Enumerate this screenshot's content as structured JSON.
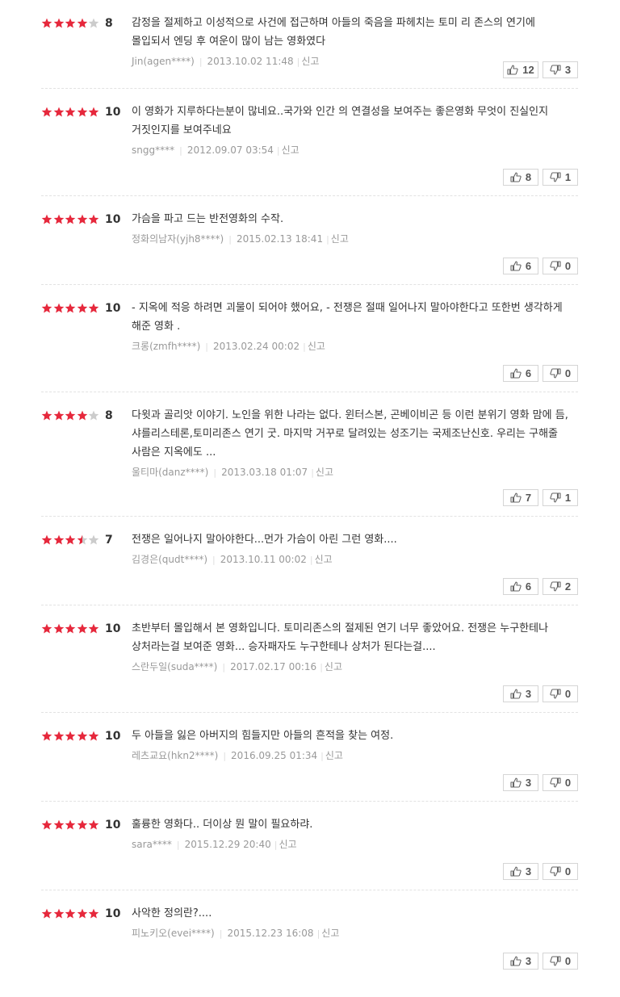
{
  "colors": {
    "star_on": "#e6283c",
    "star_off": "#cccccc"
  },
  "report_label": "신고",
  "reviews": [
    {
      "score": "8",
      "stars": [
        1,
        1,
        1,
        1,
        0
      ],
      "text": "감정을 절제하고 이성적으로 사건에 접근하며 아들의 죽음을 파헤치는 토미 리 존스의 연기에 몰입되서 엔딩 후 여운이 많이 남는 영화였다",
      "author": "Jin(agen****)",
      "date": "2013.10.02 11:48",
      "up": "12",
      "down": "3"
    },
    {
      "score": "10",
      "stars": [
        1,
        1,
        1,
        1,
        1
      ],
      "text": "이 영화가 지루하다는분이 많네요..국가와 인간 의 연결성을 보여주는 좋은영화 무엇이 진실인지 거짓인지를 보여주네요",
      "author": "sngg****",
      "date": "2012.09.07 03:54",
      "up": "8",
      "down": "1"
    },
    {
      "score": "10",
      "stars": [
        1,
        1,
        1,
        1,
        1
      ],
      "text": "가슴을 파고 드는 반전영화의 수작.",
      "author": "정화의남자(yjh8****)",
      "date": "2015.02.13 18:41",
      "up": "6",
      "down": "0"
    },
    {
      "score": "10",
      "stars": [
        1,
        1,
        1,
        1,
        1
      ],
      "text": "- 지옥에 적응 하려면 괴물이 되어야 했어요, - 전쟁은 절때 일어나지 말아야한다고 또한번 생각하게 해준 영화 .",
      "author": "크롱(zmfh****)",
      "date": "2013.02.24 00:02",
      "up": "6",
      "down": "0"
    },
    {
      "score": "8",
      "stars": [
        1,
        1,
        1,
        1,
        0
      ],
      "text": "다윗과 골리앗 이야기. 노인을 위한 나라는 없다. 윈터스본, 곤베이비곤 등 이런 분위기 영화 맘에 듬, 샤를리스테론,토미리존스 연기 굿. 마지막 거꾸로 달려있는 성조기는 국제조난신호. 우리는 구해줄 사람은 지옥에도 ...",
      "author": "울티마(danz****)",
      "date": "2013.03.18 01:07",
      "up": "7",
      "down": "1"
    },
    {
      "score": "7",
      "stars": [
        1,
        1,
        1,
        0.5,
        0
      ],
      "text": "전쟁은 일어나지 말아야한다...먼가 가슴이 아린 그런 영화....",
      "author": "김경은(qudt****)",
      "date": "2013.10.11 00:02",
      "up": "6",
      "down": "2"
    },
    {
      "score": "10",
      "stars": [
        1,
        1,
        1,
        1,
        1
      ],
      "text": "초반부터 몰입해서 본 영화입니다. 토미리존스의 절제된 연기 너무 좋았어요. 전쟁은 누구한테나 상처라는걸 보여준 영화... 승자패자도 누구한테나 상처가 된다는걸....",
      "author": "스란두일(suda****)",
      "date": "2017.02.17 00:16",
      "up": "3",
      "down": "0"
    },
    {
      "score": "10",
      "stars": [
        1,
        1,
        1,
        1,
        1
      ],
      "text": "두 아들을 잃은 아버지의 힘들지만 아들의 흔적을 찾는 여정.",
      "author": "레츠교요(hkn2****)",
      "date": "2016.09.25 01:34",
      "up": "3",
      "down": "0"
    },
    {
      "score": "10",
      "stars": [
        1,
        1,
        1,
        1,
        1
      ],
      "text": "훌륭한 영화다.. 더이상 뭔 말이 필요하랴.",
      "author": "sara****",
      "date": "2015.12.29 20:40",
      "up": "3",
      "down": "0"
    },
    {
      "score": "10",
      "stars": [
        1,
        1,
        1,
        1,
        1
      ],
      "text": "사악한 정의란?....",
      "author": "피노키오(evei****)",
      "date": "2015.12.23 16:08",
      "up": "3",
      "down": "0"
    }
  ]
}
